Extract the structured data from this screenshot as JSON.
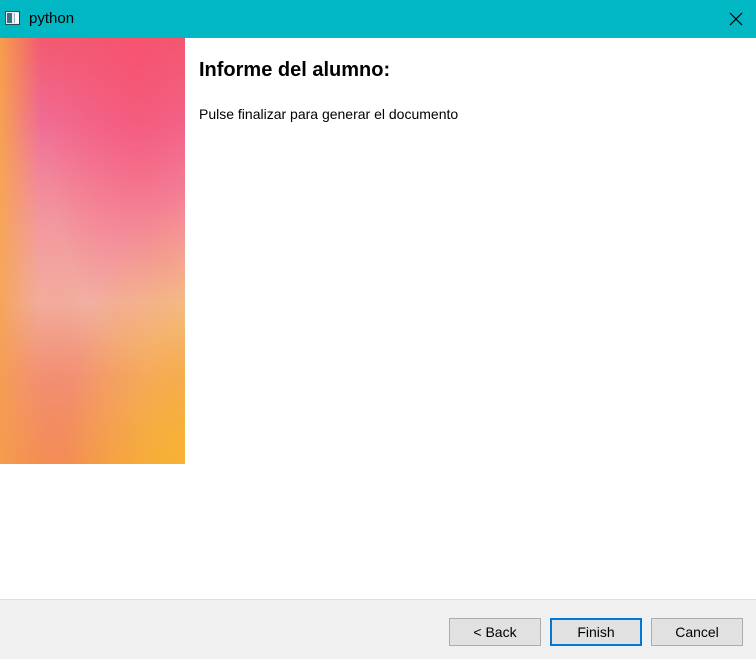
{
  "window": {
    "title": "python",
    "titlebar_color": "#00b7c3",
    "app_icon": "window-icon",
    "close_icon": "close-icon"
  },
  "banner": {
    "colors": [
      "#f25a6f",
      "#f06c95",
      "#f1c2b5",
      "#f3a244"
    ]
  },
  "page": {
    "heading": "Informe del alumno:",
    "description": "Pulse finalizar para generar el documento"
  },
  "footer": {
    "back_label": "< Back",
    "finish_label": "Finish",
    "cancel_label": "Cancel",
    "focus_color": "#0078d7"
  }
}
